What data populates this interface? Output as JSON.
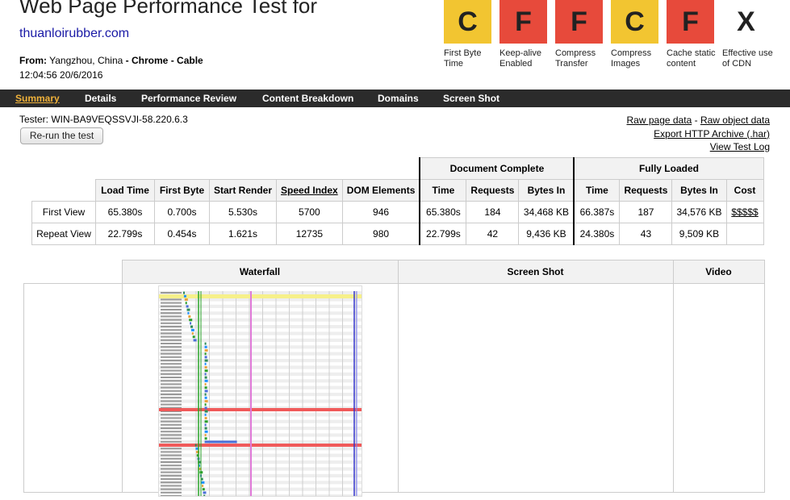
{
  "header": {
    "title": "Web Page Performance Test for",
    "site": "thuanloirubber.com",
    "from_label": "From:",
    "from_location": "Yangzhou, China",
    "dash": "-",
    "browser": "Chrome",
    "connection": "Cable",
    "datetime": "12:04:56 20/6/2016"
  },
  "grades": [
    {
      "letter": "C",
      "label": "First Byte Time",
      "color": "#f2c531"
    },
    {
      "letter": "F",
      "label": "Keep-alive Enabled",
      "color": "#e74a3b"
    },
    {
      "letter": "F",
      "label": "Compress Transfer",
      "color": "#e74a3b"
    },
    {
      "letter": "C",
      "label": "Compress Images",
      "color": "#f2c531"
    },
    {
      "letter": "F",
      "label": "Cache static content",
      "color": "#e74a3b"
    },
    {
      "letter": "X",
      "label": "Effective use of CDN",
      "color": "#ffffff"
    }
  ],
  "nav": {
    "summary": "Summary",
    "details": "Details",
    "performance_review": "Performance Review",
    "content_breakdown": "Content Breakdown",
    "domains": "Domains",
    "screen_shot": "Screen Shot"
  },
  "tester": "Tester: WIN-BA9VEQSSVJI-58.220.6.3",
  "rerun_label": "Re-run the test",
  "links": {
    "raw_page": "Raw page data",
    "separator": "-",
    "raw_object": "Raw object data",
    "export_har": "Export HTTP Archive (.har)",
    "view_log": "View Test Log"
  },
  "results": {
    "group_doc": "Document Complete",
    "group_full": "Fully Loaded",
    "cols": {
      "load_time": "Load Time",
      "first_byte": "First Byte",
      "start_render": "Start Render",
      "speed_index": "Speed Index",
      "dom_elements": "DOM Elements",
      "doc_time": "Time",
      "doc_requests": "Requests",
      "doc_bytes": "Bytes In",
      "full_time": "Time",
      "full_requests": "Requests",
      "full_bytes": "Bytes In",
      "cost": "Cost"
    },
    "first": {
      "label": "First View",
      "load_time": "65.380s",
      "first_byte": "0.700s",
      "start_render": "5.530s",
      "speed_index": "5700",
      "dom_elements": "946",
      "doc_time": "65.380s",
      "doc_requests": "184",
      "doc_bytes": "34,468 KB",
      "full_time": "66.387s",
      "full_requests": "187",
      "full_bytes": "34,576 KB",
      "cost": "$$$$$"
    },
    "repeat": {
      "label": "Repeat View",
      "load_time": "22.799s",
      "first_byte": "0.454s",
      "start_render": "1.621s",
      "speed_index": "12735",
      "dom_elements": "980",
      "doc_time": "22.799s",
      "doc_requests": "42",
      "doc_bytes": "9,436 KB",
      "full_time": "24.380s",
      "full_requests": "43",
      "full_bytes": "9,509 KB",
      "cost": ""
    }
  },
  "sections": {
    "waterfall": "Waterfall",
    "screen_shot": "Screen Shot",
    "video": "Video"
  },
  "colors": {
    "nav_bg": "#2b2b2b",
    "nav_active": "#f0b23a",
    "link_blue": "#1a1aa6"
  }
}
